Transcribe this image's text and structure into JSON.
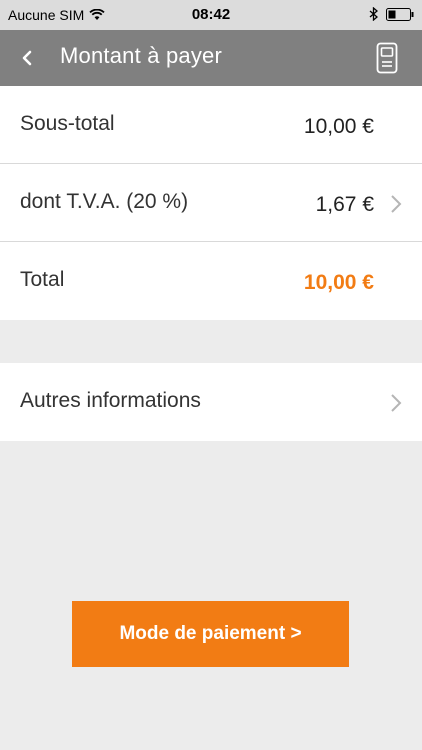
{
  "status": {
    "carrier": "Aucune SIM",
    "time": "08:42"
  },
  "nav": {
    "title": "Montant à payer"
  },
  "summary": [
    {
      "label": "Sous-total",
      "value": "10,00 €"
    },
    {
      "label": "dont T.V.A. (20 %)",
      "value": "1,67 €"
    },
    {
      "label": "Total",
      "value": "10,00 €"
    }
  ],
  "other": {
    "label": "Autres informations"
  },
  "pay_button": {
    "label": "Mode de paiement  >"
  },
  "colors": {
    "accent": "#f27c14",
    "navbar": "#808080"
  }
}
